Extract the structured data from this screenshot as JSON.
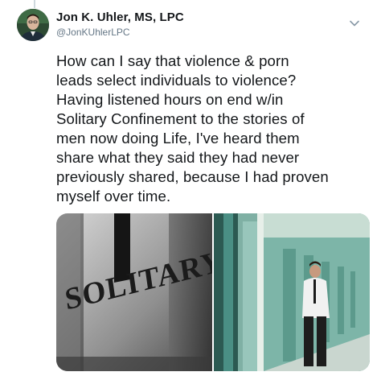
{
  "tweet": {
    "author": {
      "name": "Jon K. Uhler, MS, LPC",
      "handle": "@JonKUhlerLPC",
      "avatar_icon": "avatar-photo"
    },
    "more_icon": "chevron-down-icon",
    "text": "How can I say that violence & porn\nleads select individuals to violence?\nHaving listened hours on end w/in\nSolitary Confinement to the stories of\nmen now doing Life, I've heard them\nshare what they said they had never\npreviously shared, because I had proven\nmyself over time.",
    "media": [
      {
        "stencil_text": "SOLITARY"
      },
      {
        "scene": "prison-corridor"
      }
    ]
  },
  "colors": {
    "primary_text": "#14171a",
    "secondary_text": "#657786",
    "thread_line": "#cfd9de"
  }
}
